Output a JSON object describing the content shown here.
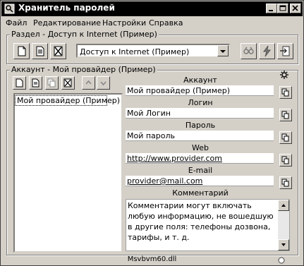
{
  "window": {
    "title": "Хранитель паролей"
  },
  "menu": [
    "Файл",
    "Редактирование",
    "Настройки",
    "Справка"
  ],
  "section_group": {
    "legend": "Раздел - Доступ к Internet (Пример)",
    "dropdown_value": "Доступ к Internet (Пример)"
  },
  "account_group": {
    "legend": "Аккаунт - Мой провайдер (Пример)",
    "list_items": [
      "Мой провайдер (Пример)"
    ]
  },
  "fields": {
    "account_label": "Аккаунт",
    "account_value": "Мой провайдер (Пример)",
    "login_label": "Логин",
    "login_value": "Мой Логин",
    "password_label": "Пароль",
    "password_value": "Мой пароль",
    "web_label": "Web",
    "web_value": "http://www.provider.com",
    "email_label": "E-mail",
    "email_value": "provider@mail.com",
    "comment_label": "Комментарий",
    "comment_value": "Комментарии могут включать любую информацию, не вошедшую в другие поля: телефоны дозвона, тарифы, и т. д."
  },
  "status": {
    "text": "Msvbvm60.dll"
  },
  "icons": {
    "app": "key-lock-icon",
    "new": "new-document-icon",
    "edit": "edit-document-icon",
    "delete": "delete-icon",
    "copy": "copy-icon",
    "search": "search-icon",
    "settings": "gear-icon"
  }
}
